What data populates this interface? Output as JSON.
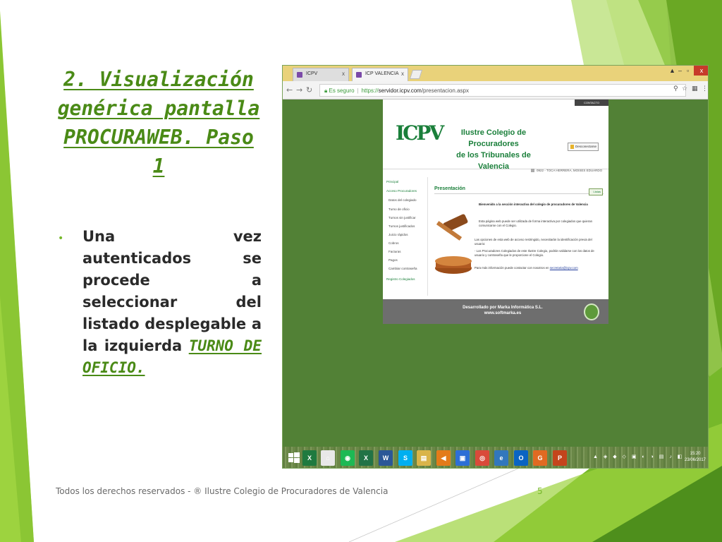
{
  "slide": {
    "title": "2. Visualización genérica pantalla PROCURAWEB. Paso 1",
    "bullet_lead": "Una vez autenticados se procede a seleccionar del listado desplegable a la izquierda",
    "bullet_highlight": "TURNO DE OFICIO.",
    "footer": "Todos los derechos reservados - ® Ilustre Colegio de Procuradores de Valencia",
    "page_number": "5",
    "accent_color": "#76b82a"
  },
  "browser": {
    "tabs": [
      {
        "label": "ICPV",
        "active": false
      },
      {
        "label": "ICP VALENCIA",
        "active": true
      }
    ],
    "tab_close": "x",
    "window_close": "x",
    "secure_label": "Es seguro",
    "url_scheme": "https://",
    "url_domain": "servidor.icpv.com",
    "url_path": "/presentacion.aspx"
  },
  "webpage": {
    "contact_label": "CONTACTO",
    "org_name_line1": "Ilustre Colegio de Procuradores",
    "org_name_line2": "de los Tribunales de Valencia",
    "logout_label": "Desconectarse",
    "user_line": "0922 - TOCA HERRERA, MOISES EDUARDO",
    "sidebar": [
      {
        "label": "Principal",
        "style": "green"
      },
      {
        "label": "Acceso Procuradores",
        "style": "green"
      },
      {
        "label": "Datos del colegiado",
        "style": "sub"
      },
      {
        "label": "Turno de oficio",
        "style": "sub"
      },
      {
        "label": "Turnos sin justificar",
        "style": "sub"
      },
      {
        "label": "Turnos justificados",
        "style": "sub"
      },
      {
        "label": "Juicio rápidos",
        "style": "sub"
      },
      {
        "label": "Cobros",
        "style": "sub"
      },
      {
        "label": "Facturas",
        "style": "sub"
      },
      {
        "label": "Pagos",
        "style": "sub"
      },
      {
        "label": "Cambiar contraseña",
        "style": "sub"
      },
      {
        "label": "Registro Colegiados",
        "style": "green"
      }
    ],
    "section_title": "Presentación",
    "section_button": "Listas",
    "welcome": "Bienvenido a la sección interactiva del colegio de procuradores de Valencia",
    "p1": "Esta página web puede ser utilizada de forma interactiva por colegiados que quieran comunicarse con el Colegio.",
    "p2": "Las opciones de esta web de acceso restringido, necesitarán la identificación previa del usuario:",
    "p3": "- Los Procuradores Colegiados de este Ilustre Colegio, podrán validarse con los datos de usuario y contraseña que le proporcione el Colegio.",
    "p4_lead": "Para más información puede contactar con nosotros en",
    "p4_link": "secretaria@icpv.com",
    "footer_line1": "Desarrollado por Marka Informática S.L.",
    "footer_line2": "www.softmarka.es"
  },
  "taskbar": {
    "icons": [
      {
        "name": "windows-icon",
        "glyph": "",
        "color": "#ffffff"
      },
      {
        "name": "spreadsheet-icon",
        "glyph": "X",
        "color": "#1f7a3f"
      },
      {
        "name": "home-icon",
        "glyph": "⌂",
        "color": "#e8e8e8"
      },
      {
        "name": "spotify-icon",
        "glyph": "◉",
        "color": "#1db954"
      },
      {
        "name": "excel-icon",
        "glyph": "X",
        "color": "#217346"
      },
      {
        "name": "word-icon",
        "glyph": "W",
        "color": "#2b5797"
      },
      {
        "name": "skype-icon",
        "glyph": "S",
        "color": "#00aff0"
      },
      {
        "name": "notes-icon",
        "glyph": "▤",
        "color": "#d9b44a"
      },
      {
        "name": "back-app-icon",
        "glyph": "◀",
        "color": "#e37b19"
      },
      {
        "name": "store-icon",
        "glyph": "▣",
        "color": "#2d6fd6"
      },
      {
        "name": "chrome-icon",
        "glyph": "◎",
        "color": "#d94a3a"
      },
      {
        "name": "edge-icon",
        "glyph": "e",
        "color": "#3277bc"
      },
      {
        "name": "outlook-icon",
        "glyph": "O",
        "color": "#0a64c2"
      },
      {
        "name": "gp-icon",
        "glyph": "G",
        "color": "#e06a22"
      },
      {
        "name": "powerpoint-icon",
        "glyph": "P",
        "color": "#c4441c"
      }
    ],
    "clock_time": "15:20",
    "clock_date": "23/06/2017"
  }
}
